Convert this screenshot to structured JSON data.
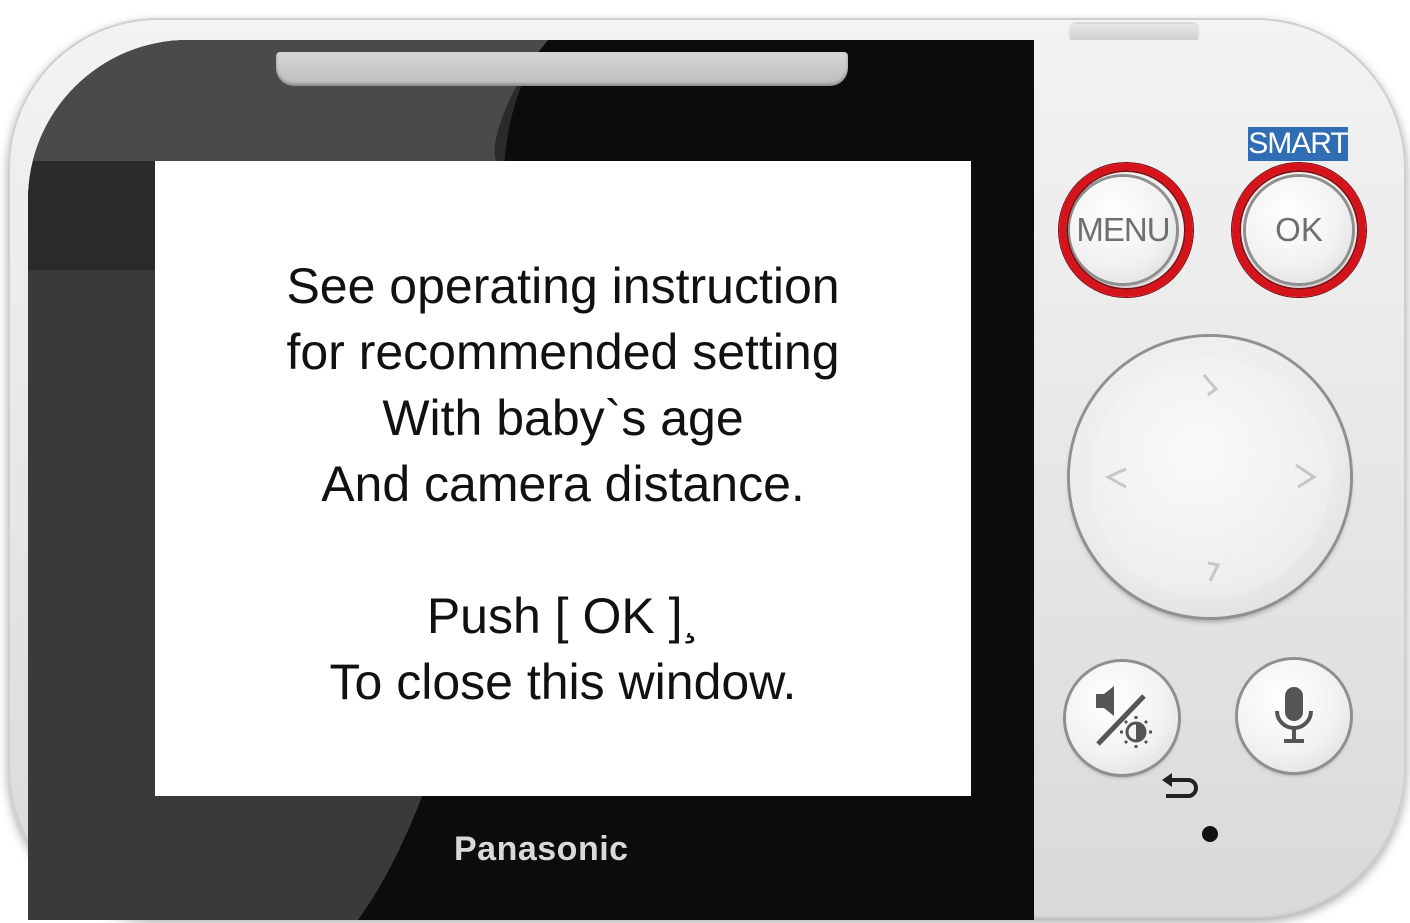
{
  "device": {
    "brand": "Panasonic",
    "smart_label": "SMART",
    "colors": {
      "highlight": "#d6131b",
      "smart_badge": "#2f6db5",
      "body": "#e6e6e6",
      "bezel": "#0c0c0c"
    }
  },
  "screen": {
    "lines": [
      "See operating instruction",
      "for recommended setting",
      "With baby`s age",
      "And camera distance.",
      "",
      "Push [ OK ]¸",
      "To close this window."
    ]
  },
  "buttons": {
    "menu_label": "MENU",
    "ok_label": "OK",
    "highlighted": [
      "MENU",
      "OK"
    ]
  },
  "icons": {
    "dpad_up": "chevron-up-icon",
    "dpad_down": "chevron-down-icon",
    "dpad_left": "chevron-left-icon",
    "dpad_right": "chevron-right-icon",
    "volume_brightness": "speaker-brightness-icon",
    "back": "back-arrow-icon",
    "talk": "microphone-icon"
  }
}
